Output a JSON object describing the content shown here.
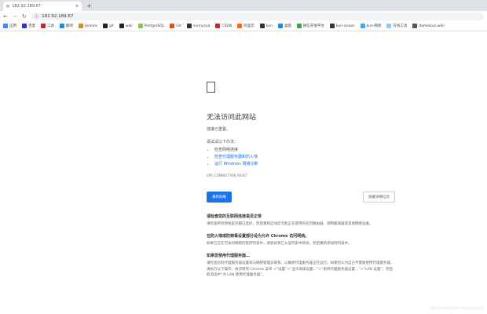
{
  "tab": {
    "title": "182.92.189.67",
    "close": "×",
    "new_tab": "+"
  },
  "toolbar": {
    "back": "←",
    "forward": "→",
    "reload": "↻",
    "url": "182.92.189.67",
    "info_icon": "ⓘ"
  },
  "bookmarks": [
    {
      "label": "应用",
      "color": "#4285f4"
    },
    {
      "label": "百度",
      "color": "#2932e1"
    },
    {
      "label": "工具",
      "color": "#c62828"
    },
    {
      "label": "翻译",
      "color": "#1e88e5"
    },
    {
      "label": "Jenkins",
      "color": "#d08b2c"
    },
    {
      "label": "git",
      "color": "#222"
    },
    {
      "label": "wiki",
      "color": "#222"
    },
    {
      "label": "PostgreSQL",
      "color": "#8bc34a"
    },
    {
      "label": "Git",
      "color": "#e64a19"
    },
    {
      "label": "sunnyzyq",
      "color": "#333"
    },
    {
      "label": "CSDN",
      "color": "#c62828"
    },
    {
      "label": "阿里云",
      "color": "#ff6a00"
    },
    {
      "label": "kun",
      "color": "#333"
    },
    {
      "label": "桌面",
      "color": "#1e88e5"
    },
    {
      "label": "微信开放平台",
      "color": "#43a047"
    },
    {
      "label": "kun-issues",
      "color": "#333"
    },
    {
      "label": "kun-网盘",
      "color": "#42a5f5"
    },
    {
      "label": "在线工具",
      "color": "#90caf9"
    },
    {
      "label": "dameikun.wiki",
      "color": "#555"
    }
  ],
  "error": {
    "title": "无法访问此网站",
    "subtitle": "连接已重置。",
    "try_label": "请试试以下办法：",
    "suggestions": [
      "检查网络连接",
      "检查代理服务器和防火墙",
      "运行 Windows 网络诊断"
    ],
    "code": "ERR_CONNECTION_RESET",
    "reload_button": "重新加载",
    "details_button": "隐藏详细信息"
  },
  "details": [
    {
      "title": "请检查您的互联网连接是否正常",
      "body": "请检查所有网线是否都已连好，然后重新启动您可能正在使用的任何路由器、调制解调器或其他网络设备。"
    },
    {
      "title": "在防火墙或防病毒设置部分设为允许 Chrome 访问网络。",
      "body": "如果它已在可访问网络的程序列表中，请尝试将它从该列表中移除，然后重新添加到列表中。"
    },
    {
      "title": "如果您使用代理服务器…",
      "body": "请检查您的代理服务器设置或与网络管理员联系，以确保代理服务器正在运行。如果您认为自己不需要使用代理服务器，请执行以下操作：依次转到 Chrome 菜单 >“设置”>“显示高级设置…”>“更改代理服务器设置…”>“LAN 设置”，然后取消选中“为 LAN 使用代理服务器”。"
    }
  ],
  "watermark": "https://blog.csdn.net/sunnyzyq"
}
